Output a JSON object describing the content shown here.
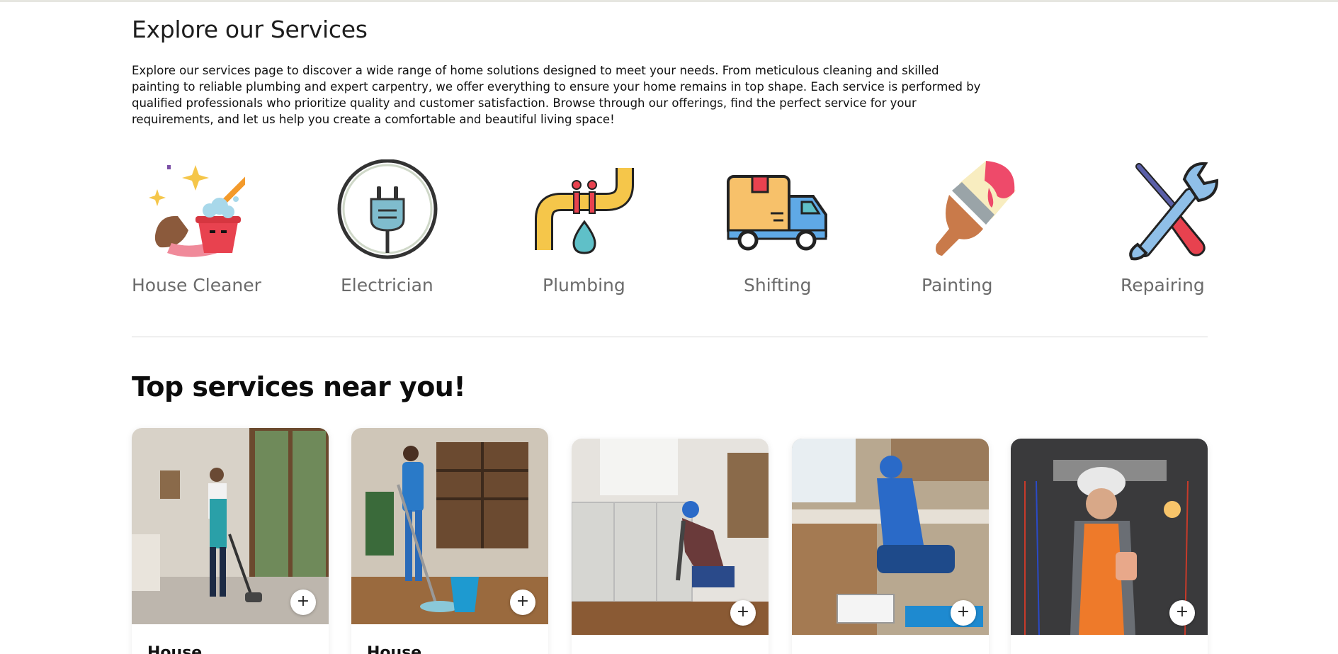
{
  "explore": {
    "title": "Explore our Services",
    "description": "Explore our services page to discover a wide range of home solutions designed to meet your needs. From meticulous cleaning and skilled painting to reliable plumbing and expert carpentry, we offer everything to ensure your home remains in top shape. Each service is performed by qualified professionals who prioritize quality and customer satisfaction. Browse through our offerings, find the perfect service for your requirements, and let us help you create a comfortable and beautiful living space!"
  },
  "categories": [
    {
      "label": "House Cleaner",
      "icon": "broom-bucket-icon"
    },
    {
      "label": "Electrician",
      "icon": "plug-icon"
    },
    {
      "label": "Plumbing",
      "icon": "pipe-drop-icon"
    },
    {
      "label": "Shifting",
      "icon": "delivery-truck-icon"
    },
    {
      "label": "Painting",
      "icon": "paintbrush-icon"
    },
    {
      "label": "Repairing",
      "icon": "wrench-screwdriver-icon"
    }
  ],
  "top_services": {
    "title": "Top services near you!",
    "cards": [
      {
        "title": "House",
        "image": "cleaner-with-vacuum-photo",
        "add_label": "+"
      },
      {
        "title": "House",
        "image": "cleaner-with-mop-photo",
        "add_label": "+"
      },
      {
        "title": "",
        "image": "plumber-under-sink-photo",
        "add_label": "+"
      },
      {
        "title": "",
        "image": "plumber-kitchen-photo",
        "add_label": "+"
      },
      {
        "title": "",
        "image": "electrician-wiring-photo",
        "add_label": "+"
      }
    ]
  },
  "colors": {
    "icon_yellow": "#f5c64a",
    "icon_red": "#e8424f",
    "icon_blue": "#5fa9e6",
    "icon_orange": "#f39a2b",
    "label_gray": "#6b6b6b"
  }
}
